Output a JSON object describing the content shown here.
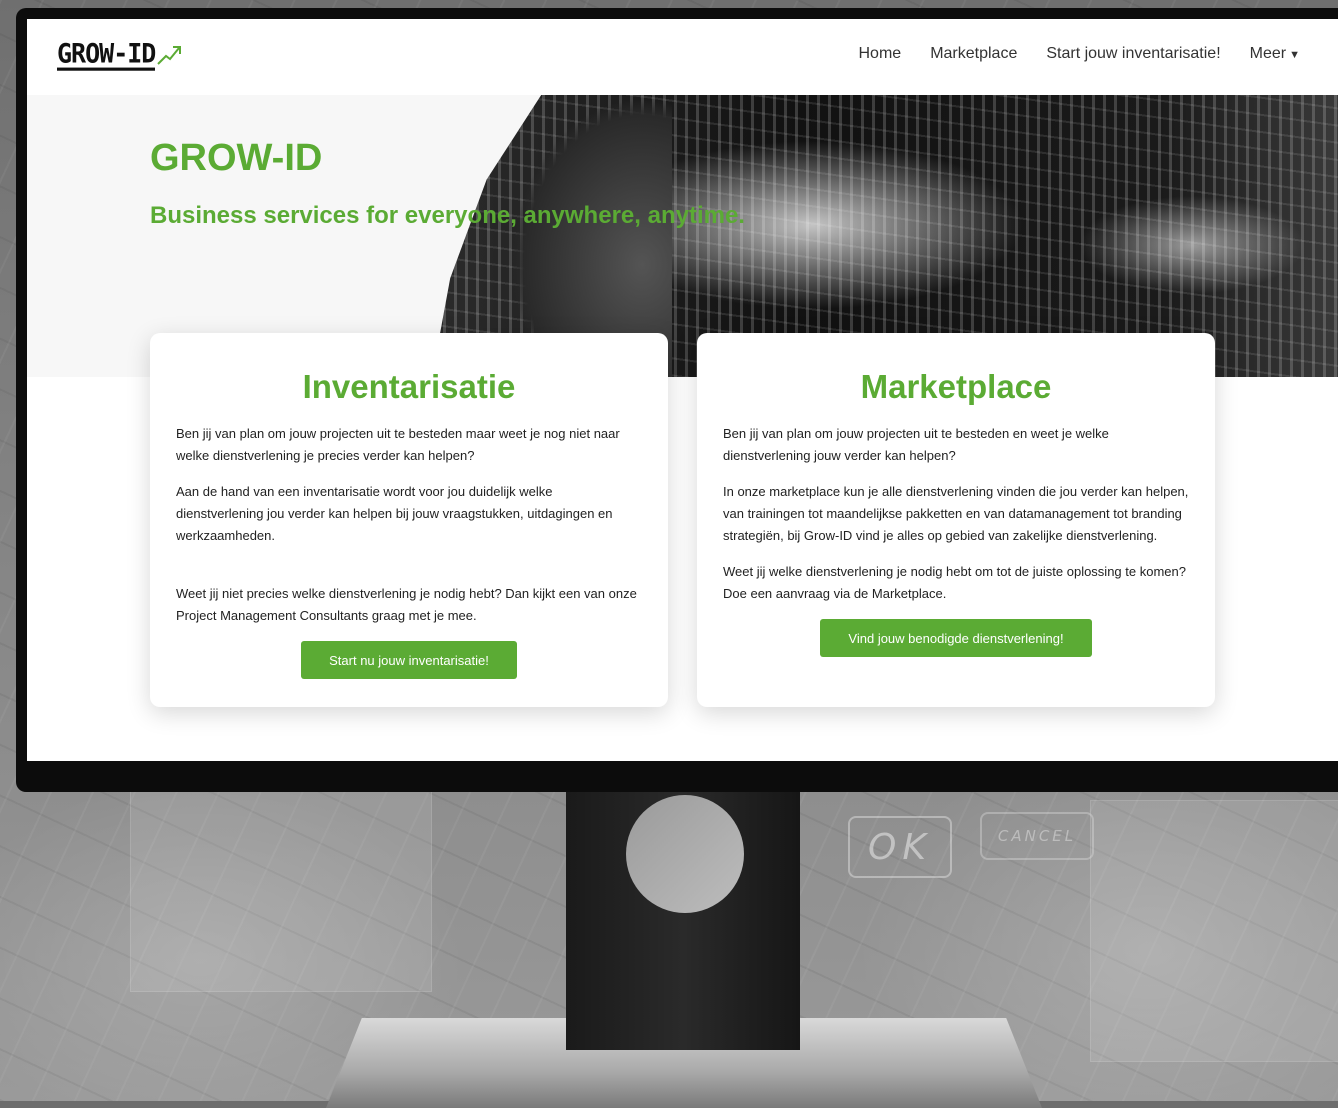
{
  "navbar": {
    "logo_text": "GROW-ID",
    "links": [
      "Home",
      "Marketplace",
      "Start jouw inventarisatie!",
      "Meer"
    ]
  },
  "hero": {
    "title": "GROW-ID",
    "subtitle": "Business services for everyone, anywhere, anytime."
  },
  "cards": [
    {
      "title": "Inventarisatie",
      "paragraphs": [
        "Ben jij van plan om jouw projecten uit te besteden maar weet je nog niet naar welke dienstverlening je precies verder kan helpen?",
        "Aan de hand van een inventarisatie wordt voor jou duidelijk welke dienstverlening jou verder kan helpen bij jouw vraagstukken, uitdagingen en werkzaamheden.",
        "Weet jij niet precies welke dienstverlening je nodig hebt? Dan kijkt een van onze Project Management Consultants graag met je mee."
      ],
      "button": "Start nu jouw inventarisatie!"
    },
    {
      "title": "Marketplace",
      "paragraphs": [
        "Ben jij van plan om jouw projecten uit te besteden en weet je welke dienstverlening jouw verder kan helpen?",
        "In onze marketplace kun je alle dienstverlening vinden die jou verder kan helpen, van trainingen tot maandelijkse pakketten en van datamanagement tot branding strategiën, bij Grow-ID vind je alles op gebied van zakelijke dienstverlening.",
        "Weet jij welke dienstverlening je nodig hebt om tot de juiste oplossing te komen? Doe een aanvraag via de Marketplace."
      ],
      "button": "Vind jouw benodigde dienstverlening!"
    }
  ],
  "background": {
    "ok_text": "OK",
    "cancel_text": "CANCEL"
  },
  "colors": {
    "brand_green": "#5bab34",
    "text_dark": "#222222"
  }
}
